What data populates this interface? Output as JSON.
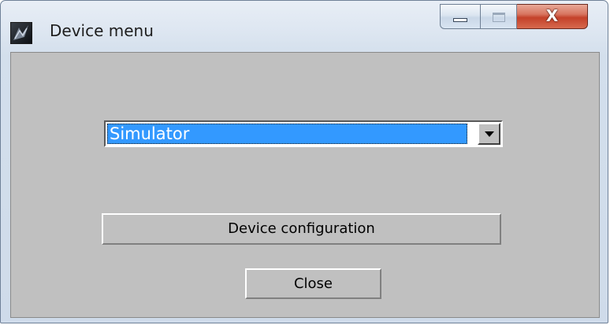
{
  "window": {
    "title": "Device menu",
    "app_icon": "app-logo-icon",
    "caption_buttons": {
      "minimize_icon": "minimize-icon",
      "maximize_icon": "maximize-icon",
      "close_glyph": "X"
    }
  },
  "device_select": {
    "selected": "Simulator",
    "arrow_icon": "dropdown-arrow-icon"
  },
  "buttons": {
    "device_configuration": "Device configuration",
    "close": "Close"
  },
  "colors": {
    "selection_highlight": "#3399ff",
    "client_background": "#c0c0c0",
    "close_button": "#c4412a"
  }
}
